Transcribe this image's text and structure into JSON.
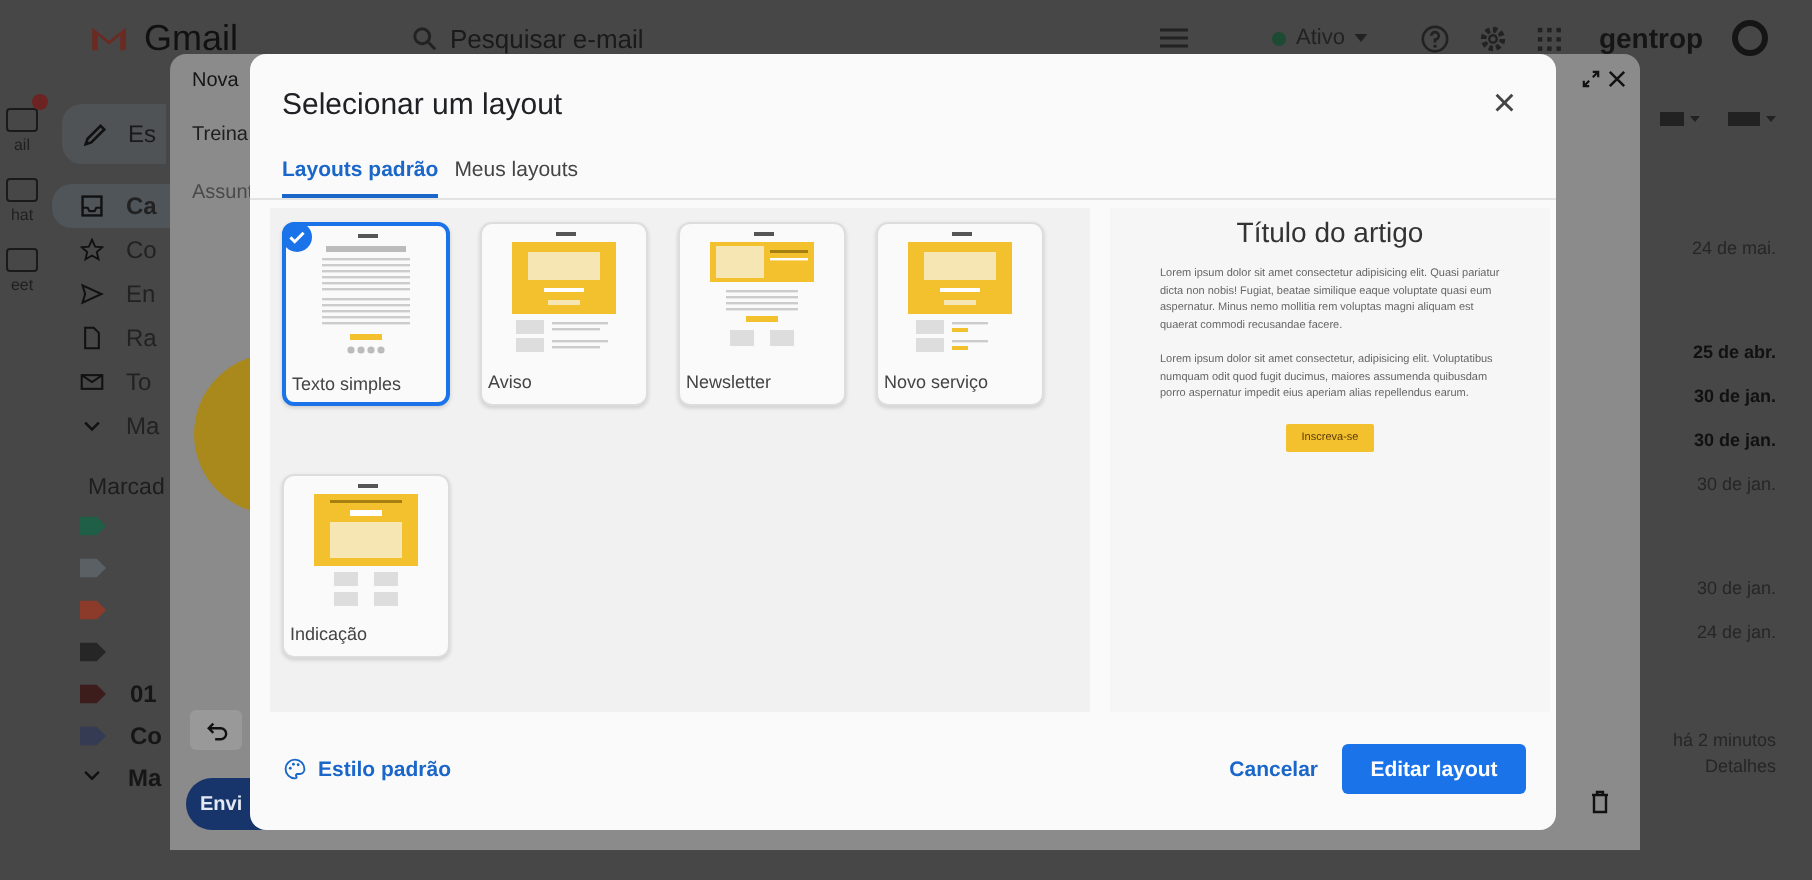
{
  "app_bar": {
    "product": "Gmail",
    "search": {
      "placeholder": "Pesquisar e-mail"
    },
    "status": "Ativo",
    "account": "gentrop"
  },
  "rail": [
    {
      "label": "ail",
      "badge": true
    },
    {
      "label": "hat",
      "badge": false
    },
    {
      "label": "eet",
      "badge": false
    }
  ],
  "nav": {
    "compose": "Es",
    "items": [
      {
        "label": "Ca",
        "kind": "inbox",
        "selected": true
      },
      {
        "label": "Co",
        "kind": "starred",
        "selected": false
      },
      {
        "label": "En",
        "kind": "sent",
        "selected": false
      },
      {
        "label": "Ra",
        "kind": "drafts",
        "selected": false
      },
      {
        "label": "To",
        "kind": "all",
        "selected": false
      },
      {
        "label": "Ma",
        "kind": "more",
        "selected": false
      }
    ],
    "labels_heading": "Marcad",
    "labels": [
      {
        "color": "#1f5f48"
      },
      {
        "color": "#5a6064"
      },
      {
        "color": "#8c3a2a"
      },
      {
        "color": "#262626"
      },
      {
        "label": "01",
        "color": "#3d1c1c"
      },
      {
        "label": "Co",
        "color": "#343b52"
      }
    ],
    "more": "Ma"
  },
  "mail_dates": [
    {
      "text": "24 de mai.",
      "unread": false
    },
    {
      "text": "25 de abr.",
      "unread": true
    },
    {
      "text": "30 de jan.",
      "unread": true
    },
    {
      "text": "30 de jan.",
      "unread": true
    },
    {
      "text": "30 de jan.",
      "unread": false
    },
    {
      "text": "30 de jan.",
      "unread": false
    },
    {
      "text": "24 de jan.",
      "unread": false
    }
  ],
  "activity": {
    "text": "há 2 minutos",
    "link": "Detalhes"
  },
  "compose": {
    "title": "Nova",
    "to": "Treina",
    "subject": "Assunt",
    "send": "Envi"
  },
  "dialog": {
    "title": "Selecionar um layout",
    "close": "×",
    "tabs": [
      {
        "label": "Layouts padrão",
        "selected": true
      },
      {
        "label": "Meus layouts",
        "selected": false
      }
    ],
    "layouts": [
      {
        "label": "Texto simples",
        "kind": "plain",
        "selected": true
      },
      {
        "label": "Aviso",
        "kind": "notice",
        "selected": false
      },
      {
        "label": "Newsletter",
        "kind": "newsletter",
        "selected": false
      },
      {
        "label": "Novo serviço",
        "kind": "service",
        "selected": false
      },
      {
        "label": "Indicação",
        "kind": "referral",
        "selected": false
      }
    ],
    "preview": {
      "title": "Título do artigo",
      "paragraphs": [
        "Lorem ipsum dolor sit amet consectetur adipisicing elit. Quasi pariatur dicta non nobis! Fugiat, beatae similique eaque voluptate quasi eum aspernatur. Minus nemo mollitia rem voluptas magni aliquam est quaerat commodi recusandae facere.",
        "Lorem ipsum dolor sit amet consectetur, adipisicing elit. Voluptatibus numquam odit quod fugit ducimus, maiores assumenda quibusdam porro aspernatur impedit eius aperiam alias repellendus earum."
      ],
      "button": "Inscreva-se"
    },
    "style_link": "Estilo padrão",
    "cancel": "Cancelar",
    "confirm": "Editar layout"
  }
}
